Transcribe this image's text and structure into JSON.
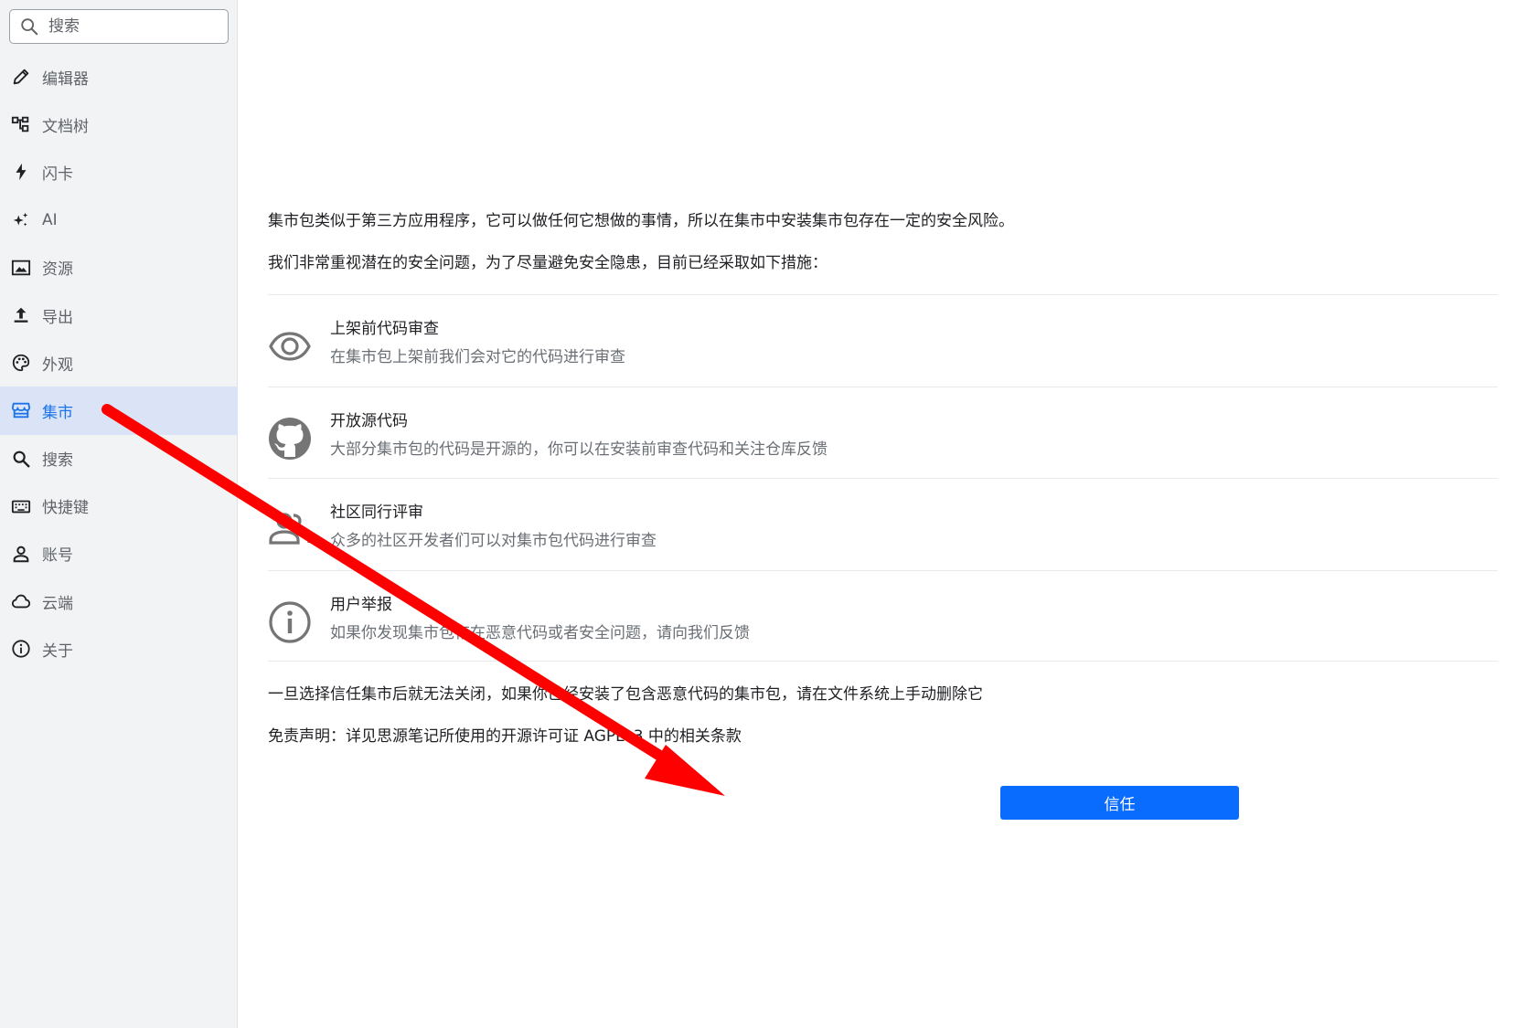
{
  "search": {
    "placeholder": "搜索"
  },
  "sidebar": {
    "items": [
      {
        "label": "编辑器",
        "icon": "pencil-icon"
      },
      {
        "label": "文档树",
        "icon": "tree-icon"
      },
      {
        "label": "闪卡",
        "icon": "lightning-icon"
      },
      {
        "label": "AI",
        "icon": "sparkle-icon"
      },
      {
        "label": "资源",
        "icon": "image-icon"
      },
      {
        "label": "导出",
        "icon": "upload-icon"
      },
      {
        "label": "外观",
        "icon": "palette-icon"
      },
      {
        "label": "集市",
        "icon": "store-icon",
        "active": true
      },
      {
        "label": "搜索",
        "icon": "search-icon"
      },
      {
        "label": "快捷键",
        "icon": "keyboard-icon"
      },
      {
        "label": "账号",
        "icon": "user-icon"
      },
      {
        "label": "云端",
        "icon": "cloud-icon"
      },
      {
        "label": "关于",
        "icon": "info-icon"
      }
    ]
  },
  "main": {
    "intro": "集市包类似于第三方应用程序，它可以做任何它想做的事情，所以在集市中安装集市包存在一定的安全风险。",
    "measures_intro": "我们非常重视潜在的安全问题，为了尽量避免安全隐患，目前已经采取如下措施：",
    "features": [
      {
        "title": "上架前代码审查",
        "desc": "在集市包上架前我们会对它的代码进行审查",
        "icon": "eye-icon"
      },
      {
        "title": "开放源代码",
        "desc": "大部分集市包的代码是开源的，你可以在安装前审查代码和关注仓库反馈",
        "icon": "github-icon"
      },
      {
        "title": "社区同行评审",
        "desc": "众多的社区开发者们可以对集市包代码进行审查",
        "icon": "community-icon"
      },
      {
        "title": "用户举报",
        "desc": "如果你发现集市包存在恶意代码或者安全问题，请向我们反馈",
        "icon": "info-icon"
      }
    ],
    "warning": "一旦选择信任集市后就无法关闭，如果你已经安装了包含恶意代码的集市包，请在文件系统上手动删除它",
    "disclaimer": "免责声明：详见思源笔记所使用的开源许可证 AGPLv3 中的相关条款",
    "trust_button": "信任"
  },
  "colors": {
    "accent": "#0a6cff",
    "sidebar_active_bg": "#dae4f6",
    "sidebar_active_text": "#1a73e8",
    "annotation_arrow": "#ff0000"
  }
}
